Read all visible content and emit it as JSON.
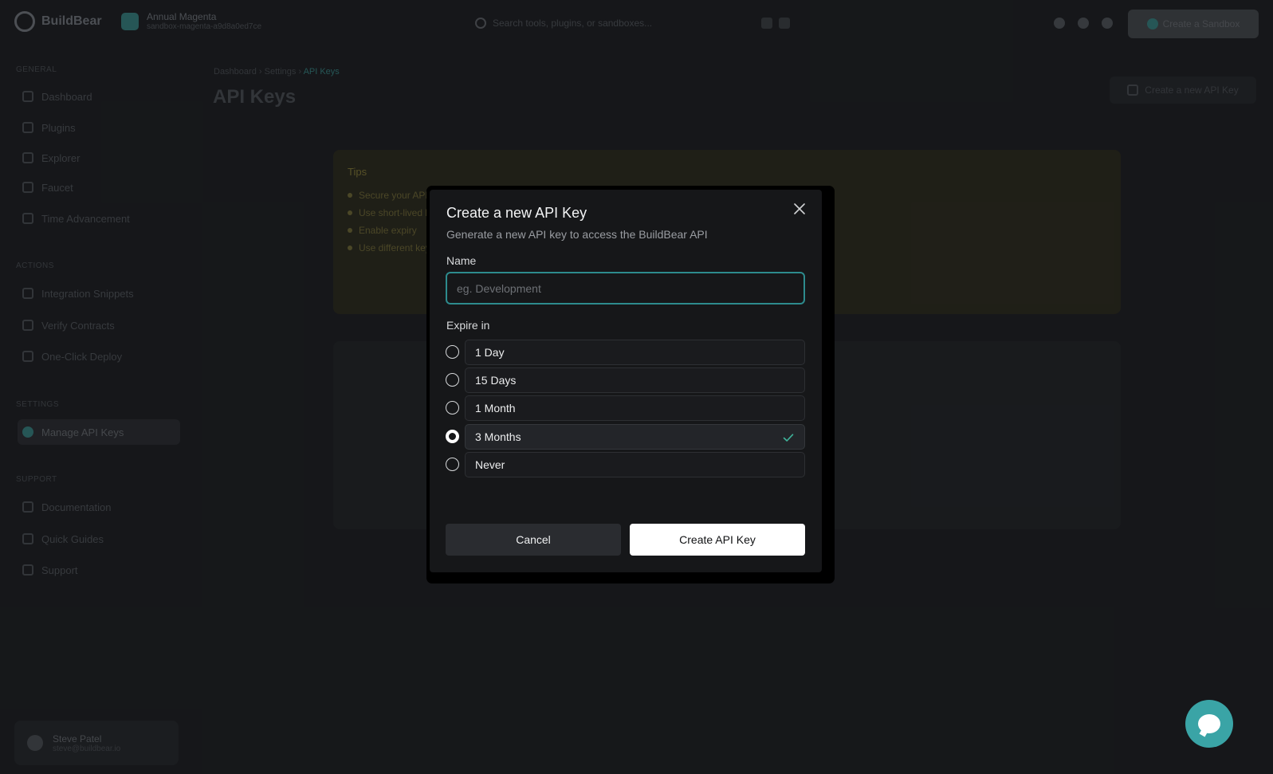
{
  "app": {
    "logo_text": "BuildBear",
    "project": {
      "name": "Annual Magenta",
      "sub": "sandbox-magenta-a9d8a0ed7ce"
    },
    "search_placeholder": "Search tools, plugins, or sandboxes...",
    "top_cta_label": "Create a Sandbox"
  },
  "sidebar": {
    "sections": [
      {
        "label": "General",
        "items": [
          "Dashboard",
          "Plugins",
          "Explorer",
          "Faucet",
          "Time Advancement"
        ]
      },
      {
        "label": "Actions",
        "items": [
          "Integration Snippets",
          "Verify Contracts",
          "One-Click Deploy"
        ]
      },
      {
        "label": "Settings",
        "items": [
          "Manage API Keys"
        ]
      },
      {
        "label": "Support",
        "items": [
          "Documentation",
          "Quick Guides",
          "Support"
        ]
      }
    ],
    "user": {
      "name": "Steve Patel",
      "email": "steve@buildbear.io"
    }
  },
  "main": {
    "breadcrumb": [
      "Dashboard",
      "Settings",
      "API Keys"
    ],
    "title": "API Keys",
    "cta_label": "Create a new API Key",
    "tips": {
      "title": "Tips",
      "items": [
        "Secure your API keys",
        "Use short-lived keys",
        "Enable expiry",
        "Use different keys"
      ]
    }
  },
  "modal": {
    "title": "Create a new API Key",
    "subtitle": "Generate a new API key to access the BuildBear API",
    "name_label": "Name",
    "name_placeholder": "eg. Development",
    "name_value": "",
    "expire_label": "Expire in",
    "options": [
      {
        "label": "1 Day",
        "selected": false
      },
      {
        "label": "15 Days",
        "selected": false
      },
      {
        "label": "1 Month",
        "selected": false
      },
      {
        "label": "3 Months",
        "selected": true
      },
      {
        "label": "Never",
        "selected": false
      }
    ],
    "cancel_label": "Cancel",
    "submit_label": "Create API Key"
  },
  "colors": {
    "accent": "#2d8b8d",
    "check": "#3fb39a",
    "chat_bubble": "#3aa4a6"
  },
  "icons": {
    "close": "close-icon",
    "check": "check-icon",
    "chat": "chat-icon"
  }
}
